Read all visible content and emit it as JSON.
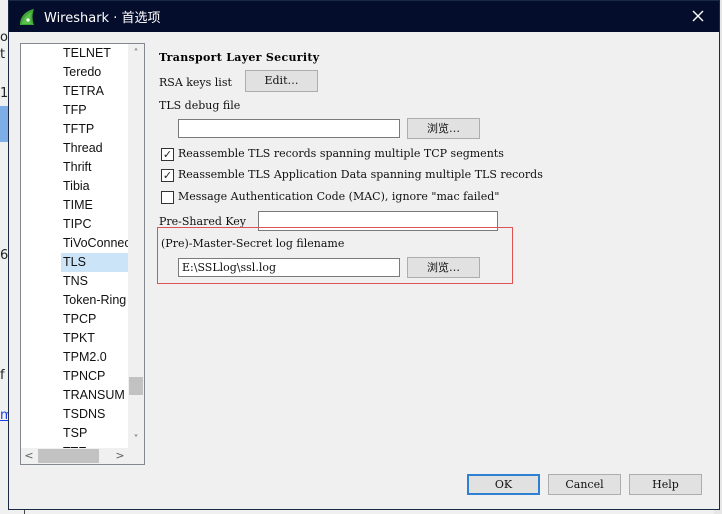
{
  "window": {
    "title": "Wireshark · 首选项",
    "close_icon": "close-icon"
  },
  "background": {
    "fragments": [
      "or",
      "t a",
      "1",
      "6",
      "f",
      "m"
    ]
  },
  "tree": {
    "items": [
      {
        "label": "TELNET"
      },
      {
        "label": "Teredo"
      },
      {
        "label": "TETRA"
      },
      {
        "label": "TFP"
      },
      {
        "label": "TFTP"
      },
      {
        "label": "Thread"
      },
      {
        "label": "Thrift"
      },
      {
        "label": "Tibia"
      },
      {
        "label": "TIME"
      },
      {
        "label": "TIPC"
      },
      {
        "label": "TiVoConnect"
      },
      {
        "label": "TLS",
        "selected": true
      },
      {
        "label": "TNS"
      },
      {
        "label": "Token-Ring"
      },
      {
        "label": "TPCP"
      },
      {
        "label": "TPKT"
      },
      {
        "label": "TPM2.0"
      },
      {
        "label": "TPNCP"
      },
      {
        "label": "TRANSUM"
      },
      {
        "label": "TSDNS"
      },
      {
        "label": "TSP"
      },
      {
        "label": "TTE"
      }
    ],
    "selected": "TLS"
  },
  "panel": {
    "title": "Transport Layer Security",
    "rsa_keys_label": "RSA keys list",
    "rsa_edit_button": "Edit…",
    "debug_file_label": "TLS debug file",
    "debug_file_value": "",
    "browse_button": "浏览…",
    "checkboxes": [
      {
        "label": "Reassemble TLS records spanning multiple TCP segments",
        "checked": true
      },
      {
        "label": "Reassemble TLS Application Data spanning multiple TLS records",
        "checked": true
      },
      {
        "label": "Message Authentication Code (MAC), ignore \"mac failed\"",
        "checked": false
      }
    ],
    "psk_label": "Pre-Shared Key",
    "psk_value": "",
    "master_secret_label": "(Pre)-Master-Secret log filename",
    "master_secret_value": "E:\\SSLlog\\ssl.log",
    "master_browse_button": "浏览…"
  },
  "footer": {
    "ok": "OK",
    "cancel": "Cancel",
    "help": "Help"
  },
  "colors": {
    "titlebar": "#050d2c",
    "selection": "#cce4f7",
    "highlight_box": "#e05252",
    "default_button_border": "#2f7fd3"
  }
}
